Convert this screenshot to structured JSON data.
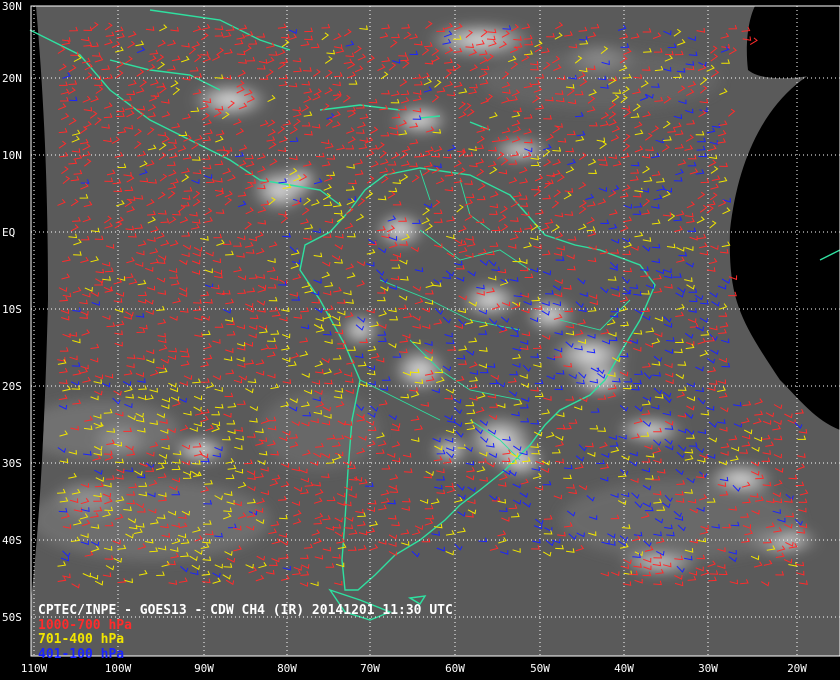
{
  "title": "CPTEC/INPE - GOES13 - CDW CH4 (IR) 20141201 11:30 UTC",
  "legend": [
    {
      "label": "1000-700 hPa",
      "color": "#ff2b2b"
    },
    {
      "label": "701-400 hPa",
      "color": "#f2e600"
    },
    {
      "label": "401-100 hPa",
      "color": "#1a24ff"
    }
  ],
  "lat_ticks": [
    "30N",
    "20N",
    "10N",
    "EQ",
    "10S",
    "20S",
    "30S",
    "40S",
    "50S"
  ],
  "lon_ticks": [
    "110W",
    "100W",
    "90W",
    "80W",
    "70W",
    "60W",
    "50W",
    "40W",
    "30W",
    "20W"
  ],
  "colors": {
    "background": "#000000",
    "coastline": "#2fe0a0",
    "grid": "#ffffff",
    "image_base": "#5a5a5a"
  },
  "map": {
    "grid": true,
    "lat_range": [
      -52,
      30
    ],
    "lon_range": [
      -110,
      -16
    ]
  }
}
